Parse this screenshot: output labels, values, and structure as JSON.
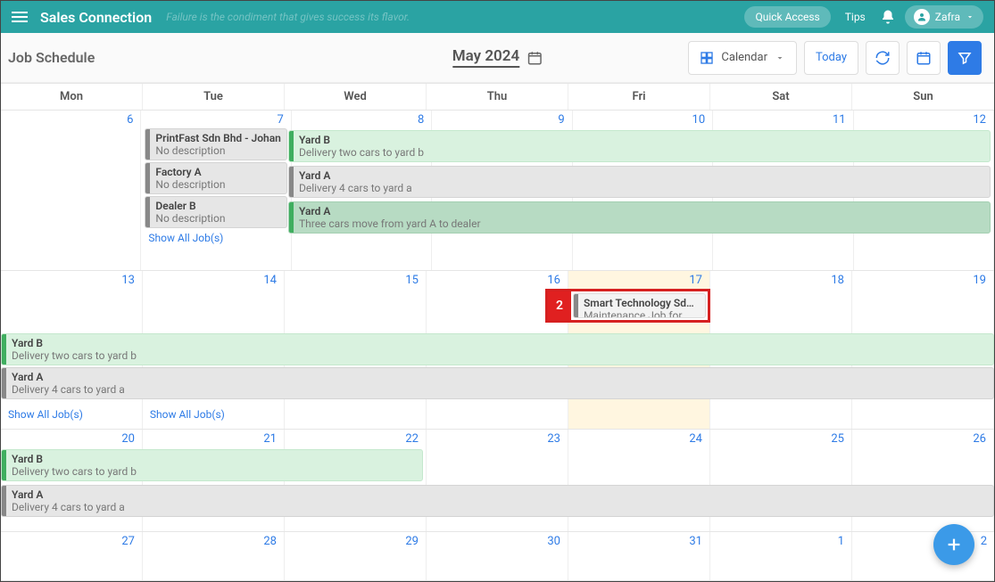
{
  "topbar": {
    "brand": "Sales Connection",
    "tagline": "Failure is the condiment that gives success its flavor.",
    "quick_access": "Quick Access",
    "tips": "Tips",
    "user": "Zafra"
  },
  "toolbar": {
    "page_title": "Job Schedule",
    "month": "May 2024",
    "view_label": "Calendar",
    "today": "Today"
  },
  "days": [
    "Mon",
    "Tue",
    "Wed",
    "Thu",
    "Fri",
    "Sat",
    "Sun"
  ],
  "weeks": [
    {
      "dates": [
        "6",
        "7",
        "8",
        "9",
        "10",
        "11",
        "12"
      ]
    },
    {
      "dates": [
        "13",
        "14",
        "15",
        "16",
        "17",
        "18",
        "19"
      ]
    },
    {
      "dates": [
        "20",
        "21",
        "22",
        "23",
        "24",
        "25",
        "26"
      ]
    },
    {
      "dates": [
        "27",
        "28",
        "29",
        "30",
        "31",
        "1",
        "2"
      ]
    }
  ],
  "today_index": {
    "week": 1,
    "col": 4
  },
  "events": {
    "w1_tue": [
      {
        "title": "PrintFast Sdn Bhd - Johan",
        "desc": "No description",
        "bar": "bar-gray",
        "bg": "ev-gray"
      },
      {
        "title": "Factory A",
        "desc": "No description",
        "bar": "bar-gray",
        "bg": "ev-gray"
      },
      {
        "title": "Dealer B",
        "desc": "No description",
        "bar": "bar-gray",
        "bg": "ev-gray"
      }
    ],
    "w1_span": [
      {
        "title": "Yard B",
        "desc": "Delivery two cars to yard b",
        "bar": "bar-green",
        "bg": "ev-green-light"
      },
      {
        "title": "Yard A",
        "desc": "Delivery 4 cars to yard a",
        "bar": "bar-gray",
        "bg": "ev-gray"
      },
      {
        "title": "Yard A",
        "desc": "Three cars move from yard A to dealer",
        "bar": "bar-green",
        "bg": "ev-green-mid"
      }
    ],
    "w2_highlight": {
      "badge": "2",
      "title": "Smart Technology Sdn B…",
      "desc": "Maintenance Job for mac…"
    },
    "w2_span": [
      {
        "title": "Yard B",
        "desc": "Delivery two cars to yard b",
        "bar": "bar-green",
        "bg": "ev-green-light"
      },
      {
        "title": "Yard A",
        "desc": "Delivery 4 cars to yard a",
        "bar": "bar-gray",
        "bg": "ev-gray"
      }
    ],
    "w3_span3": {
      "title": "Yard B",
      "desc": "Delivery two cars to yard b",
      "bar": "bar-green",
      "bg": "ev-green-light"
    },
    "w3_full": {
      "title": "Yard A",
      "desc": "Delivery 4 cars to yard a",
      "bar": "bar-gray",
      "bg": "ev-gray"
    }
  },
  "show_all": "Show All Job(s)"
}
